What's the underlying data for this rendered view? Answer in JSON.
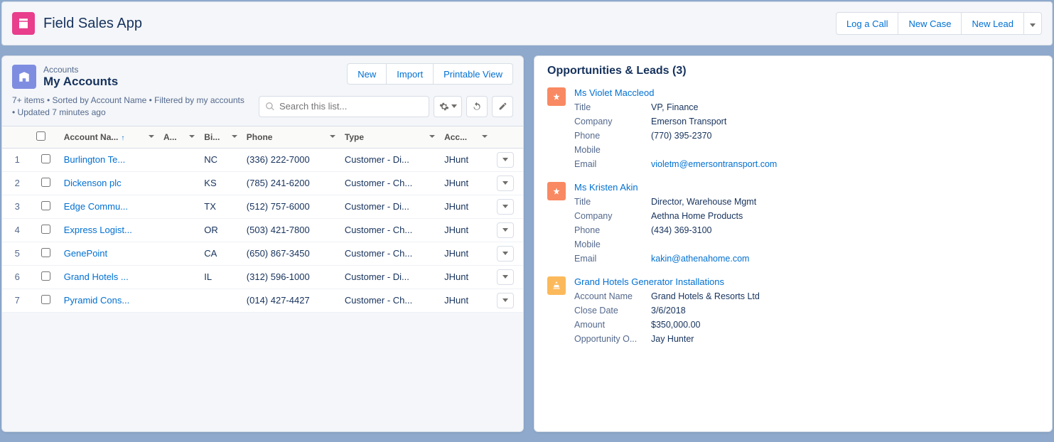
{
  "app": {
    "title": "Field Sales App"
  },
  "header_actions": {
    "log_call": "Log a Call",
    "new_case": "New Case",
    "new_lead": "New Lead"
  },
  "list_view": {
    "object_label": "Accounts",
    "title": "My Accounts",
    "meta": "7+ items • Sorted by Account Name • Filtered by my accounts • Updated 7 minutes ago",
    "buttons": {
      "new": "New",
      "import": "Import",
      "printable": "Printable View"
    },
    "search_placeholder": "Search this list...",
    "columns": {
      "name": "Account Na...",
      "a": "A...",
      "bi": "Bi...",
      "phone": "Phone",
      "type": "Type",
      "acc": "Acc..."
    },
    "rows": [
      {
        "n": "1",
        "name": "Burlington Te...",
        "state": "NC",
        "phone": "(336) 222-7000",
        "type": "Customer - Di...",
        "owner": "JHunt"
      },
      {
        "n": "2",
        "name": "Dickenson plc",
        "state": "KS",
        "phone": "(785) 241-6200",
        "type": "Customer - Ch...",
        "owner": "JHunt"
      },
      {
        "n": "3",
        "name": "Edge Commu...",
        "state": "TX",
        "phone": "(512) 757-6000",
        "type": "Customer - Di...",
        "owner": "JHunt"
      },
      {
        "n": "4",
        "name": "Express Logist...",
        "state": "OR",
        "phone": "(503) 421-7800",
        "type": "Customer - Ch...",
        "owner": "JHunt"
      },
      {
        "n": "5",
        "name": "GenePoint",
        "state": "CA",
        "phone": "(650) 867-3450",
        "type": "Customer - Ch...",
        "owner": "JHunt"
      },
      {
        "n": "6",
        "name": "Grand Hotels ...",
        "state": "IL",
        "phone": "(312) 596-1000",
        "type": "Customer - Di...",
        "owner": "JHunt"
      },
      {
        "n": "7",
        "name": "Pyramid Cons...",
        "state": "",
        "phone": "(014) 427-4427",
        "type": "Customer - Ch...",
        "owner": "JHunt"
      }
    ]
  },
  "right_panel": {
    "title": "Opportunities & Leads (3)",
    "labels": {
      "title": "Title",
      "company": "Company",
      "phone": "Phone",
      "mobile": "Mobile",
      "email": "Email",
      "account_name": "Account Name",
      "close_date": "Close Date",
      "amount": "Amount",
      "opp_owner": "Opportunity O..."
    },
    "items": [
      {
        "kind": "lead",
        "link": "Ms Violet Maccleod",
        "title": "VP, Finance",
        "company": "Emerson Transport",
        "phone": "(770) 395-2370",
        "mobile": "",
        "email": "violetm@emersontransport.com"
      },
      {
        "kind": "lead",
        "link": "Ms Kristen Akin",
        "title": "Director, Warehouse Mgmt",
        "company": "Aethna Home Products",
        "phone": "(434) 369-3100",
        "mobile": "",
        "email": "kakin@athenahome.com"
      },
      {
        "kind": "opp",
        "link": "Grand Hotels Generator Installations",
        "account_name": "Grand Hotels & Resorts Ltd",
        "close_date": "3/6/2018",
        "amount": "$350,000.00",
        "opp_owner": "Jay Hunter"
      }
    ]
  }
}
